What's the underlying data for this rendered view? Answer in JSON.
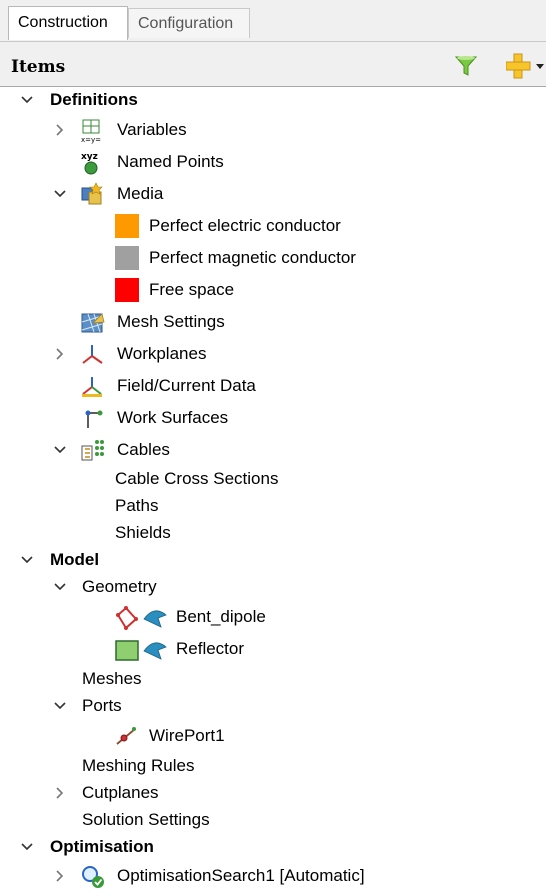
{
  "tabs": {
    "construction": "Construction",
    "configuration": "Configuration"
  },
  "items_panel": {
    "title": "Items",
    "filter_icon": "funnel-icon",
    "add_icon": "plus-dropdown-icon"
  },
  "tree": {
    "definitions": "Definitions",
    "variables": "Variables",
    "named_points": "Named Points",
    "media": "Media",
    "pec": "Perfect electric conductor",
    "pmc": "Perfect magnetic conductor",
    "free_space": "Free space",
    "mesh_settings": "Mesh Settings",
    "workplanes": "Workplanes",
    "field_current_data": "Field/Current Data",
    "work_surfaces": "Work Surfaces",
    "cables": "Cables",
    "cable_cross_sections": "Cable Cross Sections",
    "paths": "Paths",
    "shields": "Shields",
    "model": "Model",
    "geometry": "Geometry",
    "bent_dipole": "Bent_dipole",
    "reflector": "Reflector",
    "meshes": "Meshes",
    "ports": "Ports",
    "wireport1": "WirePort1",
    "meshing_rules": "Meshing Rules",
    "cutplanes": "Cutplanes",
    "solution_settings": "Solution Settings",
    "optimisation": "Optimisation",
    "optimisation_search1": "OptimisationSearch1 [Automatic]"
  },
  "colors": {
    "pec": "#ff9900",
    "pmc": "#a0a0a0",
    "free_space": "#ff0000"
  }
}
